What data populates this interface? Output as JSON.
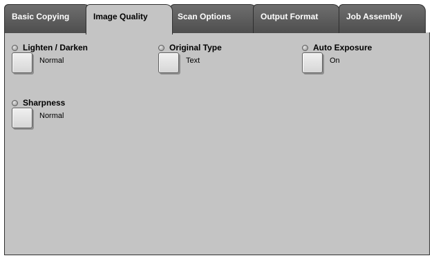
{
  "tabs": [
    {
      "label": "Basic Copying",
      "active": false
    },
    {
      "label": "Image Quality",
      "active": true
    },
    {
      "label": "Scan Options",
      "active": false
    },
    {
      "label": "Output Format",
      "active": false
    },
    {
      "label": "Job Assembly",
      "active": false
    }
  ],
  "features": {
    "lighten_darken": {
      "title": "Lighten / Darken",
      "value": "Normal"
    },
    "original_type": {
      "title": "Original Type",
      "value": "Text"
    },
    "auto_exposure": {
      "title": "Auto Exposure",
      "value": "On"
    },
    "sharpness": {
      "title": "Sharpness",
      "value": "Normal"
    }
  },
  "colors": {
    "panel": "#c4c4c4",
    "tab_inactive": "#5a5a5a",
    "border": "#2e2e2e"
  }
}
